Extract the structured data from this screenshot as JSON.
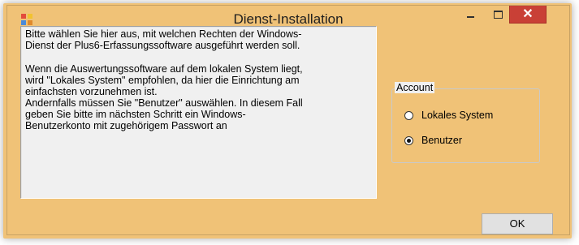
{
  "window": {
    "title": "Dienst-Installation",
    "icon": "app-icon",
    "controls": {
      "minimize": "minimize-icon",
      "maximize": "maximize-icon",
      "close": "close-icon",
      "close_glyph": "✕"
    },
    "frame_color": "#f0c277",
    "close_color": "#c94036"
  },
  "description": {
    "paragraph1": "Bitte wählen Sie hier aus, mit welchen Rechten der Windows-\nDienst der Plus6-Erfassungssoftware ausgeführt werden soll.",
    "paragraph2": "Wenn die Auswertungssoftware auf dem lokalen System liegt,\nwird \"Lokales System\" empfohlen, da hier die Einrichtung am\neinfachsten vorzunehmen ist.\nAndernfalls müssen Sie \"Benutzer\" auswählen. In diesem Fall\ngeben Sie bitte im nächsten Schritt ein Windows-\nBenutzerkonto mit zugehörigem Passwort an"
  },
  "account": {
    "legend": "Account",
    "options": [
      {
        "label": "Lokales System",
        "selected": false
      },
      {
        "label": "Benutzer",
        "selected": true
      }
    ]
  },
  "buttons": {
    "ok": "OK"
  }
}
